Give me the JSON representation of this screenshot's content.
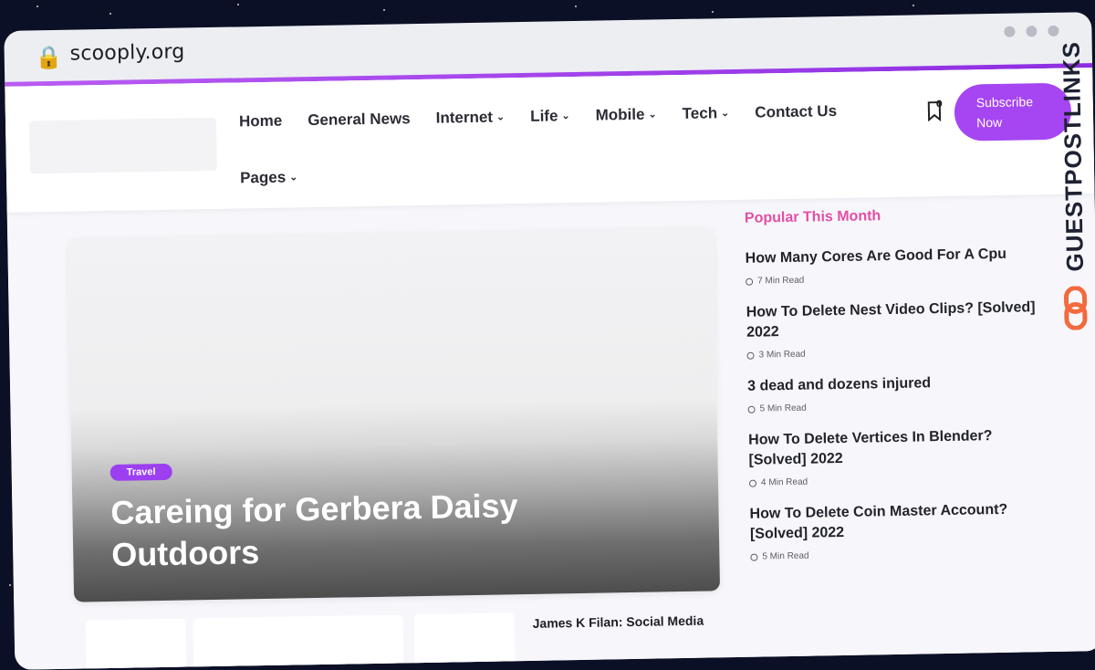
{
  "browser": {
    "url": "scooply.org",
    "lock_icon": "lock-icon"
  },
  "header": {
    "nav": [
      {
        "label": "Home",
        "has_dropdown": false
      },
      {
        "label": "General News",
        "has_dropdown": false
      },
      {
        "label": "Internet",
        "has_dropdown": true
      },
      {
        "label": "Life",
        "has_dropdown": true
      },
      {
        "label": "Mobile",
        "has_dropdown": true
      },
      {
        "label": "Tech",
        "has_dropdown": true
      },
      {
        "label": "Contact Us",
        "has_dropdown": false
      },
      {
        "label": "Pages",
        "has_dropdown": true
      }
    ],
    "bookmark_count": "0",
    "subscribe_line1": "Subscribe",
    "subscribe_line2": "Now"
  },
  "watermark": {
    "text": "GUESTPOSTLINKS"
  },
  "hero": {
    "tag": "Travel",
    "title": "Careing for Gerbera Daisy Outdoors"
  },
  "cards": {
    "title": "James K Filan: Social Media"
  },
  "sidebar": {
    "heading": "Popular This Month",
    "items": [
      {
        "title": "How Many Cores Are Good For A Cpu",
        "meta": "7 Min Read"
      },
      {
        "title": "How To Delete Nest Video Clips? [Solved] 2022",
        "meta": "3 Min Read"
      },
      {
        "title": "3 dead and dozens injured",
        "meta": "5 Min Read"
      },
      {
        "title": "How To Delete Vertices In Blender? [Solved] 2022",
        "meta": "4 Min Read"
      },
      {
        "title": "How To Delete Coin Master Account? [Solved] 2022",
        "meta": "5 Min Read"
      }
    ]
  },
  "colors": {
    "accent": "#a645f2",
    "heading_pink": "#e24fa7",
    "watermark_orange": "#f26a3d"
  }
}
